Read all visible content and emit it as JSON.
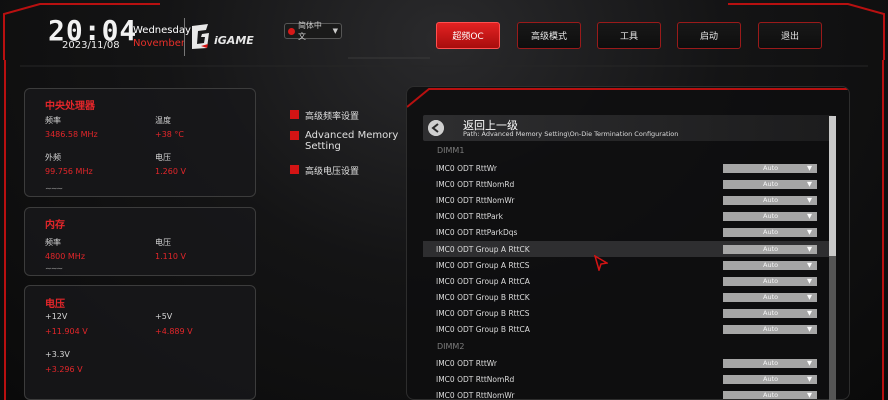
{
  "header": {
    "time": "20:04",
    "date": "2023/11/08",
    "weekday": "Wednesday",
    "month": "November",
    "logo": "iGAME",
    "language": "简体中文"
  },
  "tabs": [
    {
      "label": "超频OC",
      "active": true
    },
    {
      "label": "高级模式",
      "active": false
    },
    {
      "label": "工具",
      "active": false
    },
    {
      "label": "启动",
      "active": false
    },
    {
      "label": "退出",
      "active": false
    }
  ],
  "cpu": {
    "title": "中央处理器",
    "freq_label": "频率",
    "freq_value": "3486.58 MHz",
    "temp_label": "温度",
    "temp_value": "+38 °C",
    "ext_label": "外频",
    "ext_value": "99.756 MHz",
    "volt_label": "电压",
    "volt_value": "1.260 V"
  },
  "memory": {
    "title": "内存",
    "freq_label": "频率",
    "freq_value": "4800 MHz",
    "volt_label": "电压",
    "volt_value": "1.110 V"
  },
  "voltage": {
    "title": "电压",
    "v12_label": "+12V",
    "v12_value": "+11.904 V",
    "v5_label": "+5V",
    "v5_value": "+4.889 V",
    "v33_label": "+3.3V",
    "v33_value": "+3.296 V"
  },
  "sidebar": [
    {
      "label": "高级频率设置"
    },
    {
      "label": "Advanced Memory Setting"
    },
    {
      "label": "高级电压设置"
    }
  ],
  "content": {
    "back_label": "返回上一级",
    "path": "Path: Advanced Memory Setting\\On-Die Termination Configuration",
    "dimm1": "DIMM1",
    "dimm2": "DIMM2",
    "rows": [
      {
        "label": "IMC0 ODT RttWr",
        "value": "Auto"
      },
      {
        "label": "IMC0 ODT RttNomRd",
        "value": "Auto"
      },
      {
        "label": "IMC0 ODT RttNomWr",
        "value": "Auto"
      },
      {
        "label": "IMC0 ODT RttPark",
        "value": "Auto"
      },
      {
        "label": "IMC0 ODT RttParkDqs",
        "value": "Auto"
      },
      {
        "label": "IMC0 ODT Group A RttCK",
        "value": "Auto"
      },
      {
        "label": "IMC0 ODT Group A RttCS",
        "value": "Auto"
      },
      {
        "label": "IMC0 ODT Group A RttCA",
        "value": "Auto"
      },
      {
        "label": "IMC0 ODT Group B RttCK",
        "value": "Auto"
      },
      {
        "label": "IMC0 ODT Group B RttCS",
        "value": "Auto"
      },
      {
        "label": "IMC0 ODT Group B RttCA",
        "value": "Auto"
      },
      {
        "label": "IMC0 ODT RttWr",
        "value": "Auto"
      },
      {
        "label": "IMC0 ODT RttNomRd",
        "value": "Auto"
      },
      {
        "label": "IMC0 ODT RttNomWr",
        "value": "Auto"
      }
    ]
  },
  "colors": {
    "accent": "#d31414",
    "frame": "#b81010",
    "panel_text": "#e3262a"
  }
}
